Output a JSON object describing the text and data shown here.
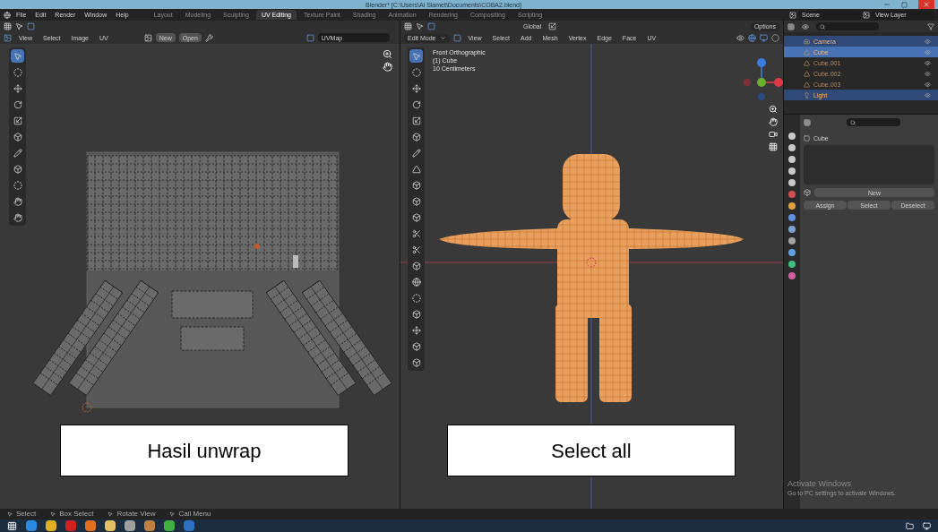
{
  "window": {
    "title": "Blender* [C:\\Users\\Ai Slamet\\Documents\\COBA2.blend]"
  },
  "menu": [
    "File",
    "Edit",
    "Render",
    "Window",
    "Help"
  ],
  "workspaces": [
    {
      "label": "Layout",
      "selected": false
    },
    {
      "label": "Modeling",
      "selected": false
    },
    {
      "label": "Sculpting",
      "selected": false
    },
    {
      "label": "UV Editing",
      "selected": true
    },
    {
      "label": "Texture Paint",
      "selected": false
    },
    {
      "label": "Shading",
      "selected": false
    },
    {
      "label": "Animation",
      "selected": false
    },
    {
      "label": "Rendering",
      "selected": false
    },
    {
      "label": "Compositing",
      "selected": false
    },
    {
      "label": "Scripting",
      "selected": false
    }
  ],
  "scene": {
    "scene": "Scene",
    "view_layer": "View Layer"
  },
  "uv_editor": {
    "menus": [
      "View",
      "Select",
      "Image",
      "UV"
    ],
    "new_label": "New",
    "open_label": "Open",
    "uv_map": "UVMap"
  },
  "viewport": {
    "mode": "Edit Mode",
    "menus": [
      "View",
      "Select",
      "Add",
      "Mesh",
      "Vertex",
      "Edge",
      "Face",
      "UV"
    ],
    "orientation": "Global",
    "options": "Options",
    "overlay_lines": [
      "Front Orthographic",
      "(1) Cube",
      "10 Centimeters"
    ]
  },
  "outliner": {
    "items": [
      {
        "name": "Camera",
        "selected": true,
        "active": false
      },
      {
        "name": "Cube",
        "selected": true,
        "active": true
      },
      {
        "name": "Cube.001",
        "selected": false,
        "active": false
      },
      {
        "name": "Cube.002",
        "selected": false,
        "active": false
      },
      {
        "name": "Cube.003",
        "selected": false,
        "active": false
      },
      {
        "name": "Light",
        "selected": true,
        "active": false
      }
    ]
  },
  "properties": {
    "object": "Cube",
    "new_label": "New",
    "actions": [
      "Assign",
      "Select",
      "Deselect"
    ]
  },
  "activation_notice": {
    "title": "Activate Windows",
    "subtitle": "Go to PC settings to activate Windows."
  },
  "status_bar": [
    "Select",
    "Box Select",
    "Rotate View",
    "Call Menu"
  ],
  "captions": [
    "Hasil unwrap",
    "Select all"
  ]
}
